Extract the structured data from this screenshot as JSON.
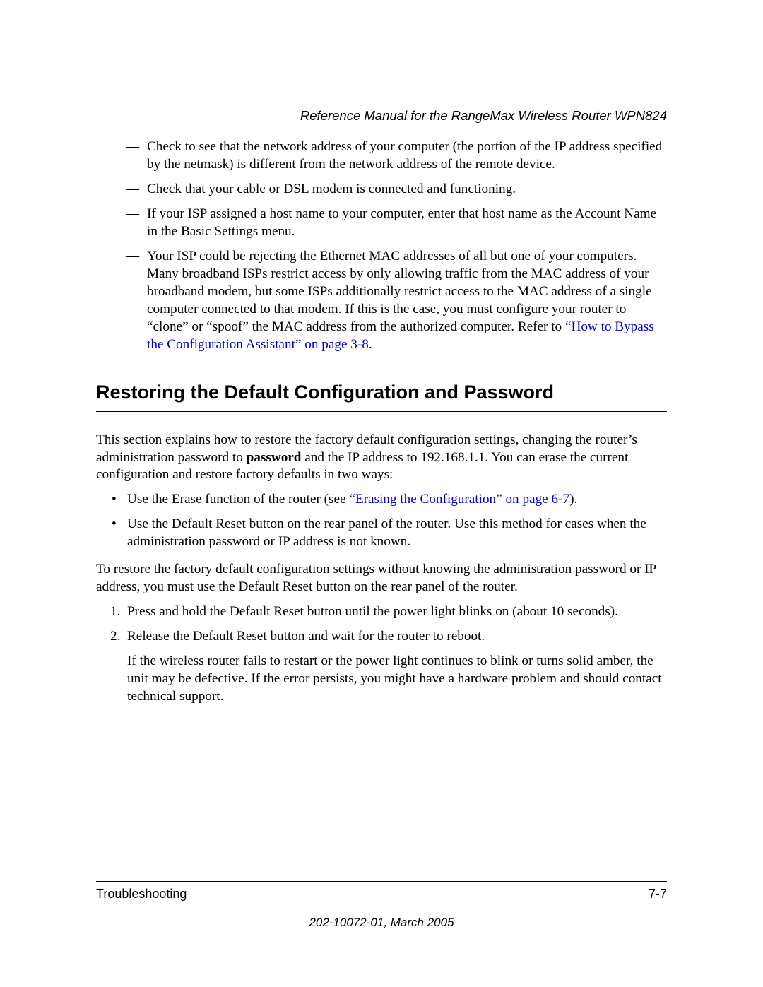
{
  "header": {
    "doc_title": "Reference Manual for the RangeMax Wireless Router WPN824"
  },
  "dash_items": [
    "Check to see that the network address of your computer (the portion of the IP address specified by the netmask) is different from the network address of the remote device.",
    "Check that your cable or DSL modem is connected and functioning.",
    "If your ISP assigned a host name to your computer, enter that host name as the Account Name in the Basic Settings menu."
  ],
  "dash_item4_pre": "Your ISP could be rejecting the Ethernet MAC addresses of all but one of your computers. Many broadband ISPs restrict access by only allowing traffic from the MAC address of your broadband modem, but some ISPs additionally restrict access to the MAC address of a single computer connected to that modem. If this is the case, you must configure your router to “clone” or “spoof” the MAC address from the authorized computer. Refer to ",
  "dash_item4_link": "“How to Bypass the Configuration Assistant” on page 3-8",
  "dash_item4_post": ".",
  "heading": "Restoring the Default Configuration and Password",
  "para1_pre": "This section explains how to restore the factory default configuration settings, changing the router’s administration password to ",
  "para1_bold": "password",
  "para1_post": " and the IP address to 192.168.1.1. You can erase the current configuration and restore factory defaults in two ways:",
  "bullets": {
    "b1_pre": "Use the Erase function of the router (see ",
    "b1_link": "“Erasing the Configuration” on page 6-7",
    "b1_post": ").",
    "b2": "Use the Default Reset button on the rear panel of the router. Use this method for cases when the administration password or IP address is not known."
  },
  "para2": "To restore the factory default configuration settings without knowing the administration password or IP address, you must use the Default Reset button on the rear panel of the router.",
  "steps": {
    "s1_num": "1.",
    "s1": "Press and hold the Default Reset button until the power light blinks on (about 10 seconds).",
    "s2_num": "2.",
    "s2": "Release the Default Reset button and wait for the router to reboot.",
    "s2_after": "If the wireless router fails to restart or the power light continues to blink or turns solid amber, the unit may be defective. If the error persists, you might have a hardware problem and should contact technical support."
  },
  "footer": {
    "section": "Troubleshooting",
    "page": "7-7",
    "docnum": "202-10072-01, March 2005"
  }
}
